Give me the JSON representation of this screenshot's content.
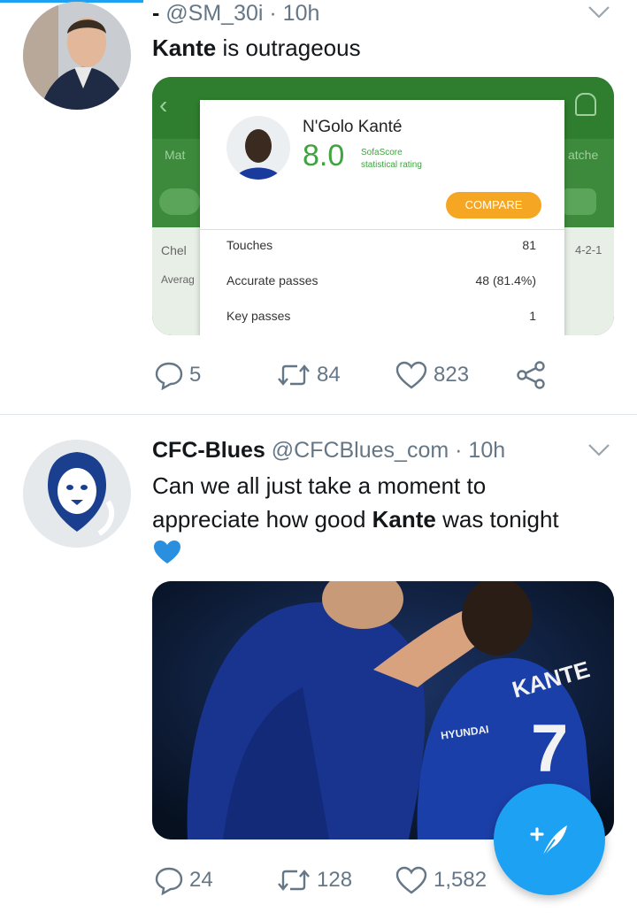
{
  "tweet1": {
    "display_name": "-",
    "handle": "@SM_30i",
    "time": "· 10h",
    "text_bold": "Kante",
    "text_rest": " is outrageous",
    "card": {
      "player_name": "N'Golo Kanté",
      "rating": "8.0",
      "rating_source": "SofaScore",
      "rating_caption": "statistical rating",
      "compare_label": "COMPARE",
      "bg_left_1": "Chel",
      "bg_left_2": "Averag",
      "bg_left_top": "Mat",
      "bg_right_1": "4-2-1",
      "bg_right_top": "atche",
      "stats": [
        {
          "label": "Touches",
          "value": "81"
        },
        {
          "label": "Accurate passes",
          "value": "48 (81.4%)"
        },
        {
          "label": "Key passes",
          "value": "1"
        }
      ]
    },
    "replies": "5",
    "retweets": "84",
    "likes": "823"
  },
  "tweet2": {
    "display_name": "CFC-Blues",
    "handle": "@CFCBlues_com",
    "time": "· 10h",
    "text_line1": "Can we all just take a moment to",
    "text_line2_pre": "appreciate how good ",
    "text_line2_bold": "Kante",
    "text_line2_post": " was tonight",
    "photo": {
      "shirt_name": "KANTE",
      "shirt_number": "7",
      "sponsor": "HYUNDAI"
    },
    "replies": "24",
    "retweets": "128",
    "likes": "1,582"
  },
  "colors": {
    "accent": "#1da1f2",
    "muted": "#657786",
    "sofascore_green": "#2e8b2e",
    "compare_orange": "#f5a623",
    "chelsea_blue": "#1a3a9e"
  },
  "icons": [
    "reply-icon",
    "retweet-icon",
    "like-icon",
    "share-icon",
    "chevron-down-icon",
    "heart-emoji-icon",
    "compose-tweet-icon"
  ]
}
